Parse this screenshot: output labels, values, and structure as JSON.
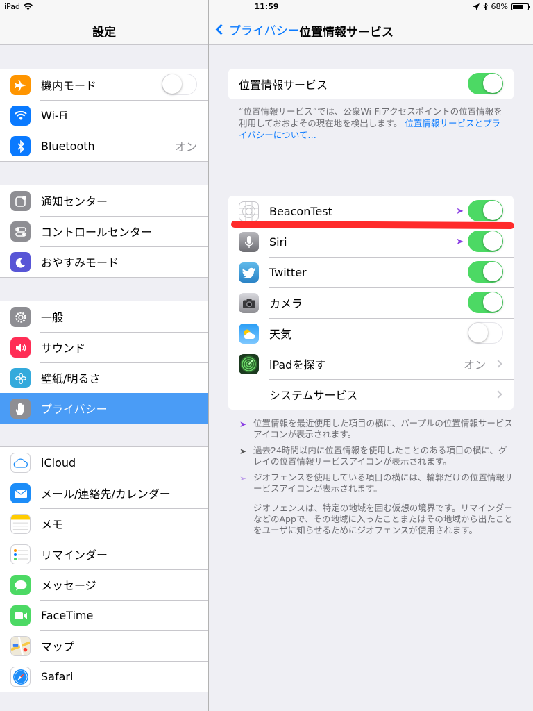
{
  "status": {
    "device": "iPad",
    "time": "11:59",
    "battery": "68%",
    "battery_level": 0.68
  },
  "left": {
    "title": "設定",
    "groups": [
      [
        {
          "label": "機内モード",
          "icon": "airplane-icon",
          "color": "#ff9500",
          "toggle": "off"
        },
        {
          "label": "Wi-Fi",
          "icon": "wifi-icon",
          "color": "#0a7aff"
        },
        {
          "label": "Bluetooth",
          "icon": "bluetooth-icon",
          "color": "#0a7aff",
          "value": "オン"
        }
      ],
      [
        {
          "label": "通知センター",
          "icon": "notification-center-icon",
          "color": "#8e8e93"
        },
        {
          "label": "コントロールセンター",
          "icon": "control-center-icon",
          "color": "#8e8e93"
        },
        {
          "label": "おやすみモード",
          "icon": "moon-icon",
          "color": "#5856d6"
        }
      ],
      [
        {
          "label": "一般",
          "icon": "gear-icon",
          "color": "#8e8e93"
        },
        {
          "label": "サウンド",
          "icon": "sound-icon",
          "color": "#ff2d55"
        },
        {
          "label": "壁紙/明るさ",
          "icon": "wallpaper-icon",
          "color": "#34aadc"
        },
        {
          "label": "プライバシー",
          "icon": "hand-icon",
          "color": "#8e8e93",
          "selected": true
        }
      ],
      [
        {
          "label": "iCloud",
          "icon": "cloud-icon",
          "color": "#ffffff"
        },
        {
          "label": "メール/連絡先/カレンダー",
          "icon": "mail-icon",
          "color": "#1d8df8"
        },
        {
          "label": "メモ",
          "icon": "notes-icon",
          "color": "#ffffff"
        },
        {
          "label": "リマインダー",
          "icon": "reminders-icon",
          "color": "#ffffff"
        },
        {
          "label": "メッセージ",
          "icon": "messages-icon",
          "color": "#4cd964"
        },
        {
          "label": "FaceTime",
          "icon": "facetime-icon",
          "color": "#4cd964"
        },
        {
          "label": "マップ",
          "icon": "maps-icon",
          "color": "#e8e3d3"
        },
        {
          "label": "Safari",
          "icon": "safari-icon",
          "color": "#ffffff"
        }
      ]
    ]
  },
  "right": {
    "back_label": "プライバシー",
    "title": "位置情報サービス",
    "main_toggle_label": "位置情報サービス",
    "main_toggle": "on",
    "description": "“位置情報サービス”では、公衆Wi-Fiアクセスポイントの位置情報を利用しておおよその現在地を検出します。",
    "description_link": "位置情報サービスとプライバシーについて…",
    "apps": [
      {
        "label": "BeaconTest",
        "icon": "beacontest-icon",
        "toggle": "on",
        "arrow": "purple"
      },
      {
        "label": "Siri",
        "icon": "siri-icon",
        "toggle": "on",
        "arrow": "purple"
      },
      {
        "label": "Twitter",
        "icon": "twitter-icon",
        "toggle": "on"
      },
      {
        "label": "カメラ",
        "icon": "camera-icon",
        "toggle": "on"
      },
      {
        "label": "天気",
        "icon": "weather-icon",
        "toggle": "off"
      },
      {
        "label": "iPadを探す",
        "icon": "find-ipad-icon",
        "value": "オン",
        "chevron": true
      },
      {
        "label": "システムサービス",
        "chevron": true
      }
    ],
    "legend": [
      {
        "mark": "purple-arrow",
        "text": "位置情報を最近使用した項目の横に、パープルの位置情報サービスアイコンが表示されます。"
      },
      {
        "mark": "gray-arrow",
        "text": "過去24時間以内に位置情報を使用したことのある項目の横に、グレイの位置情報サービスアイコンが表示されます。"
      },
      {
        "mark": "outline-arrow",
        "text": "ジオフェンスを使用している項目の横には、輪郭だけの位置情報サービスアイコンが表示されます。"
      },
      {
        "mark": "",
        "text": "ジオフェンスは、特定の地域を囲む仮想の境界です。リマインダーなどのAppで、その地域に入ったことまたはその地域から出たことをユーザに知らせるためにジオフェンスが使用されます。"
      }
    ]
  }
}
